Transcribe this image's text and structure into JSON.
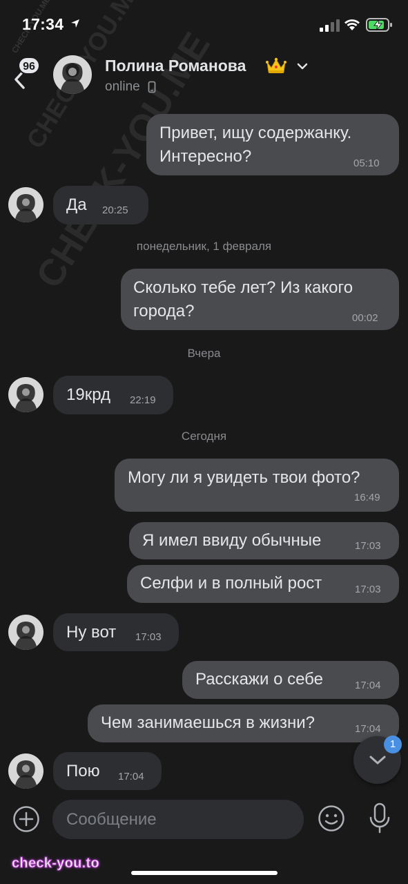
{
  "status_bar": {
    "time": "17:34"
  },
  "header": {
    "back_badge": "96",
    "contact_name": "Полина Романова",
    "contact_status": "online"
  },
  "messages": [
    {
      "dir": "out",
      "text": "Привет, ищу содержанку.",
      "text2": "Интересно?",
      "time": "05:10"
    },
    {
      "dir": "in",
      "text": "Да",
      "time": "20:25"
    },
    {
      "dir": "out",
      "text": "Сколько тебе лет? Из какого",
      "text2": "города?",
      "time": "00:02"
    },
    {
      "dir": "in",
      "text": "19крд",
      "time": "22:19"
    },
    {
      "dir": "out",
      "text": "Могу ли я увидеть твои фото?",
      "time": "16:49"
    },
    {
      "dir": "out",
      "text": "Я имел ввиду обычные",
      "time": "17:03"
    },
    {
      "dir": "out",
      "text": "Селфи и в полный рост",
      "time": "17:03"
    },
    {
      "dir": "in",
      "text": "Ну вот",
      "time": "17:03"
    },
    {
      "dir": "out",
      "text": "Расскажи о себе",
      "time": "17:04"
    },
    {
      "dir": "out",
      "text": "Чем занимаешься в жизни?",
      "time": "17:04"
    },
    {
      "dir": "in",
      "text": "Пою",
      "time": "17:04"
    }
  ],
  "date_separators": {
    "monday": "понедельник, 1 февраля",
    "yesterday": "Вчера",
    "today": "Сегодня"
  },
  "scroll_button": {
    "unread": "1"
  },
  "composer": {
    "placeholder": "Сообщение"
  },
  "watermark": {
    "bottom": "check-you.to",
    "diagonal_1": "CHECK-YOU.ME",
    "diagonal_2": "CHECK-YOU.ME",
    "diagonal_small": "CHECK-YOU.ME"
  },
  "colors": {
    "background": "#19191a",
    "bubble_out": "#4a4b4f",
    "bubble_in": "#2d2e31",
    "accent": "#4a90e2"
  }
}
